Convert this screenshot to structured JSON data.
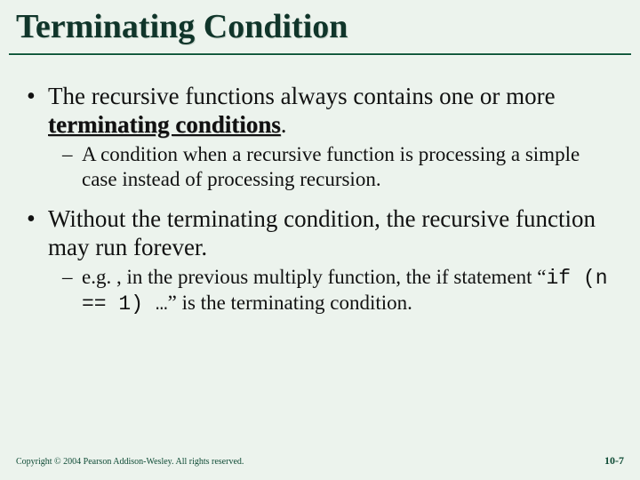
{
  "title": "Terminating Condition",
  "bullet1_part1": "The recursive functions always contains one or more ",
  "bullet1_bold": "terminating conditions",
  "bullet1_part2": ".",
  "sub1": "A condition when a recursive function is processing a simple case instead of processing recursion.",
  "bullet2": "Without the terminating condition, the recursive function may run forever.",
  "sub2_part1": "e.g. , in the previous multiply function, the if statement “",
  "sub2_code": "if (n == 1) …",
  "sub2_part2": "” is the terminating condition.",
  "copyright": "Copyright © 2004 Pearson Addison-Wesley. All rights reserved.",
  "pagenum": "10-7"
}
